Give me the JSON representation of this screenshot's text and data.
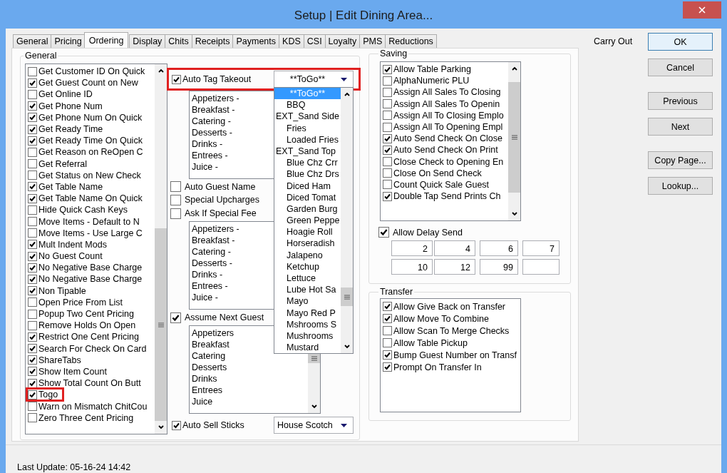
{
  "window": {
    "title": "Setup | Edit Dining Area..."
  },
  "tabs": [
    {
      "label": "General",
      "selected": false
    },
    {
      "label": "Pricing",
      "selected": false
    },
    {
      "label": "Ordering",
      "selected": true
    },
    {
      "label": "Display",
      "selected": false
    },
    {
      "label": "Chits",
      "selected": false
    },
    {
      "label": "Receipts",
      "selected": false
    },
    {
      "label": "Payments",
      "selected": false
    },
    {
      "label": "KDS",
      "selected": false
    },
    {
      "label": "CSI",
      "selected": false
    },
    {
      "label": "Loyalty",
      "selected": false
    },
    {
      "label": "PMS",
      "selected": false
    },
    {
      "label": "Reductions",
      "selected": false
    }
  ],
  "general": {
    "label": "General",
    "options": [
      {
        "label": "Get Customer ID On Quick",
        "checked": false,
        "highlighted": false
      },
      {
        "label": "Get Guest Count on New",
        "checked": true,
        "highlighted": false
      },
      {
        "label": "Get Online ID",
        "checked": false,
        "highlighted": false
      },
      {
        "label": "Get Phone Num",
        "checked": true,
        "highlighted": false
      },
      {
        "label": "Get Phone Num On Quick",
        "checked": true,
        "highlighted": false
      },
      {
        "label": "Get Ready Time",
        "checked": true,
        "highlighted": false
      },
      {
        "label": "Get Ready Time On Quick",
        "checked": true,
        "highlighted": false
      },
      {
        "label": "Get Reason on ReOpen C",
        "checked": false,
        "highlighted": false
      },
      {
        "label": "Get Referral",
        "checked": false,
        "highlighted": false
      },
      {
        "label": "Get Status on New Check",
        "checked": false,
        "highlighted": false
      },
      {
        "label": "Get Table Name",
        "checked": true,
        "highlighted": false
      },
      {
        "label": "Get Table Name On Quick",
        "checked": true,
        "highlighted": false
      },
      {
        "label": "Hide Quick Cash Keys",
        "checked": false,
        "highlighted": false
      },
      {
        "label": "Move Items - Default to N",
        "checked": false,
        "highlighted": false
      },
      {
        "label": "Move Items - Use Large C",
        "checked": false,
        "highlighted": false
      },
      {
        "label": "Mult Indent Mods",
        "checked": true,
        "highlighted": false
      },
      {
        "label": "No Guest Count",
        "checked": true,
        "highlighted": false
      },
      {
        "label": "No Negative Base Charge",
        "checked": true,
        "highlighted": false
      },
      {
        "label": "No Negative Base Charge",
        "checked": true,
        "highlighted": false
      },
      {
        "label": "Non Tipable",
        "checked": true,
        "highlighted": false
      },
      {
        "label": "Open Price From List",
        "checked": false,
        "highlighted": false
      },
      {
        "label": "Popup Two Cent Pricing",
        "checked": false,
        "highlighted": false
      },
      {
        "label": "Remove Holds On Open",
        "checked": false,
        "highlighted": false
      },
      {
        "label": "Restrict One Cent Pricing",
        "checked": true,
        "highlighted": false
      },
      {
        "label": "Search For Check On Card",
        "checked": true,
        "highlighted": false
      },
      {
        "label": "ShareTabs",
        "checked": true,
        "highlighted": false
      },
      {
        "label": "Show Item Count",
        "checked": true,
        "highlighted": false
      },
      {
        "label": "Show Total Count On Butt",
        "checked": true,
        "highlighted": false
      },
      {
        "label": "Togo",
        "checked": true,
        "highlighted": true
      },
      {
        "label": "Warn on Mismatch ChitCou",
        "checked": false,
        "highlighted": false
      },
      {
        "label": "Zero Three Cent Pricing",
        "checked": false,
        "highlighted": false
      }
    ]
  },
  "middle": [
    {
      "kind": "check_combo",
      "label": "Auto Tag Takeout",
      "checked": true,
      "highlighted": true,
      "value": "**ToGo**",
      "expanded": true,
      "options": [
        {
          "label": "**ToGo**",
          "selected": true,
          "children": [
            {
              "label": "BBQ",
              "selected": false
            }
          ]
        },
        {
          "label": "EXT_Sand Side",
          "selected": false,
          "children": [
            {
              "label": "Fries",
              "selected": false
            },
            {
              "label": "Loaded Fries",
              "selected": false
            }
          ]
        },
        {
          "label": "EXT_Sand Top",
          "selected": false,
          "children": [
            {
              "label": "Blue Chz Crr",
              "selected": false
            },
            {
              "label": "Blue Chz Drs",
              "selected": false
            },
            {
              "label": "Diced Ham",
              "selected": false
            },
            {
              "label": "Diced Tomat",
              "selected": false
            },
            {
              "label": "Garden Burg",
              "selected": false
            },
            {
              "label": "Green Peppe",
              "selected": false
            },
            {
              "label": "Hoagie Roll",
              "selected": false
            },
            {
              "label": "Horseradish",
              "selected": false
            },
            {
              "label": "Jalapeno",
              "selected": false
            },
            {
              "label": "Ketchup",
              "selected": false
            },
            {
              "label": "Lettuce",
              "selected": false
            },
            {
              "label": "Lube Hot Sa",
              "selected": false
            },
            {
              "label": "Mayo",
              "selected": false
            },
            {
              "label": "Mayo Red P",
              "selected": false
            },
            {
              "label": "Mshrooms S",
              "selected": false
            },
            {
              "label": "Mushrooms",
              "selected": false
            },
            {
              "label": "Mustard",
              "selected": false
            }
          ]
        }
      ]
    },
    {
      "kind": "list",
      "items": [
        "Appetizers -",
        "Breakfast -",
        "Catering -",
        "Desserts -",
        "Drinks -",
        "Entrees -",
        "Juice -"
      ]
    },
    {
      "kind": "check",
      "label": "Auto Guest Name",
      "checked": false
    },
    {
      "kind": "check",
      "label": "Special Upcharges",
      "checked": false
    },
    {
      "kind": "check",
      "label": "Ask If Special Fee",
      "checked": false
    },
    {
      "kind": "list",
      "items": [
        "Appetizers -",
        "Breakfast -",
        "Catering -",
        "Desserts -",
        "Drinks -",
        "Entrees -",
        "Juice -"
      ]
    },
    {
      "kind": "check",
      "label": "Assume Next Guest",
      "checked": true
    },
    {
      "kind": "scroll_list",
      "items": [
        "Appetizers",
        "Breakfast",
        "Catering",
        "Desserts",
        "Drinks",
        "Entrees",
        "Juice"
      ]
    },
    {
      "kind": "check_combo",
      "label": "Auto Sell Sticks",
      "checked": true,
      "highlighted": false,
      "value": "House Scotch",
      "expanded": false
    }
  ],
  "saving": {
    "label": "Saving",
    "options": [
      {
        "label": "Allow Table Parking",
        "checked": true
      },
      {
        "label": "AlphaNumeric PLU",
        "checked": false
      },
      {
        "label": "Assign All Sales To Closing",
        "checked": false
      },
      {
        "label": "Assign All Sales To Openin",
        "checked": false
      },
      {
        "label": "Assign All To Closing Emplo",
        "checked": false
      },
      {
        "label": "Assign All To Opening Empl",
        "checked": false
      },
      {
        "label": "Auto Send Check On Close",
        "checked": true
      },
      {
        "label": "Auto Send Check On Print",
        "checked": true
      },
      {
        "label": "Close Check to Opening En",
        "checked": false
      },
      {
        "label": "Close On Send Check",
        "checked": false
      },
      {
        "label": "Count Quick Sale Guest",
        "checked": false
      },
      {
        "label": "Double Tap Send Prints Ch",
        "checked": true
      }
    ],
    "delay_send": {
      "label": "Allow Delay Send",
      "checked": true
    },
    "delay_values": [
      "2",
      "4",
      "6",
      "7",
      "10",
      "12",
      "99"
    ]
  },
  "transfer": {
    "label": "Transfer",
    "options": [
      {
        "label": "Allow Give Back on Transfer",
        "checked": true
      },
      {
        "label": "Allow Move To Combine",
        "checked": true
      },
      {
        "label": "Allow Scan To Merge Checks",
        "checked": false
      },
      {
        "label": "Allow Table Pickup",
        "checked": false
      },
      {
        "label": "Bump Guest Number on Transf",
        "checked": true
      },
      {
        "label": "Prompt On Transfer In",
        "checked": true
      }
    ]
  },
  "side": {
    "mode": "Carry Out",
    "button_groups": [
      [
        {
          "label": "OK",
          "default": true
        },
        {
          "label": "Cancel",
          "default": false
        }
      ],
      [
        {
          "label": "Previous",
          "default": false
        },
        {
          "label": "Next",
          "default": false
        }
      ],
      [
        {
          "label": "Copy Page...",
          "default": false
        },
        {
          "label": "Lookup...",
          "default": false
        }
      ]
    ]
  },
  "status": {
    "last_update": "Last Update: 05-16-24 14:42"
  }
}
